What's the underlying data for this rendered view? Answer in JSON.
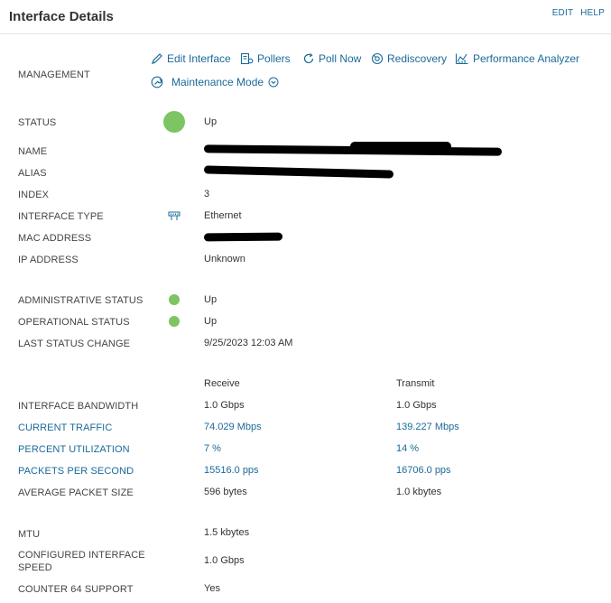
{
  "header": {
    "title": "Interface Details",
    "edit": "EDIT",
    "help": "HELP"
  },
  "management": {
    "label": "MANAGEMENT",
    "edit_interface": "Edit Interface",
    "pollers": "Pollers",
    "poll_now": "Poll Now",
    "rediscovery": "Rediscovery",
    "performance_analyzer": "Performance Analyzer",
    "maintenance_mode": "Maintenance Mode"
  },
  "status": {
    "label": "STATUS",
    "value": "Up",
    "color": "#7dc462"
  },
  "name": {
    "label": "NAME"
  },
  "alias": {
    "label": "ALIAS"
  },
  "index": {
    "label": "INDEX",
    "value": "3"
  },
  "interface_type": {
    "label": "INTERFACE TYPE",
    "value": "Ethernet"
  },
  "mac_address": {
    "label": "MAC ADDRESS"
  },
  "ip_address": {
    "label": "IP ADDRESS",
    "value": "Unknown"
  },
  "admin_status": {
    "label": "ADMINISTRATIVE STATUS",
    "value": "Up"
  },
  "oper_status": {
    "label": "OPERATIONAL STATUS",
    "value": "Up"
  },
  "last_status_change": {
    "label": "LAST STATUS CHANGE",
    "value": "9/25/2023 12:03 AM"
  },
  "traffic_headers": {
    "receive": "Receive",
    "transmit": "Transmit"
  },
  "interface_bandwidth": {
    "label": "INTERFACE BANDWIDTH",
    "receive": "1.0 Gbps",
    "transmit": "1.0 Gbps"
  },
  "current_traffic": {
    "label": "CURRENT TRAFFIC",
    "receive": "74.029 Mbps",
    "transmit": "139.227 Mbps"
  },
  "percent_utilization": {
    "label": "PERCENT UTILIZATION",
    "receive": "7 %",
    "transmit": "14 %"
  },
  "packets_per_second": {
    "label": "PACKETS PER SECOND",
    "receive": "15516.0 pps",
    "transmit": "16706.0 pps"
  },
  "average_packet_size": {
    "label": "AVERAGE PACKET SIZE",
    "receive": "596 bytes",
    "transmit": "1.0 kbytes"
  },
  "mtu": {
    "label": "MTU",
    "value": "1.5 kbytes"
  },
  "configured_speed": {
    "label_line1": "CONFIGURED INTERFACE",
    "label_line2": "SPEED",
    "value": "1.0 Gbps"
  },
  "counter64": {
    "label": "COUNTER 64 SUPPORT",
    "value": "Yes"
  }
}
